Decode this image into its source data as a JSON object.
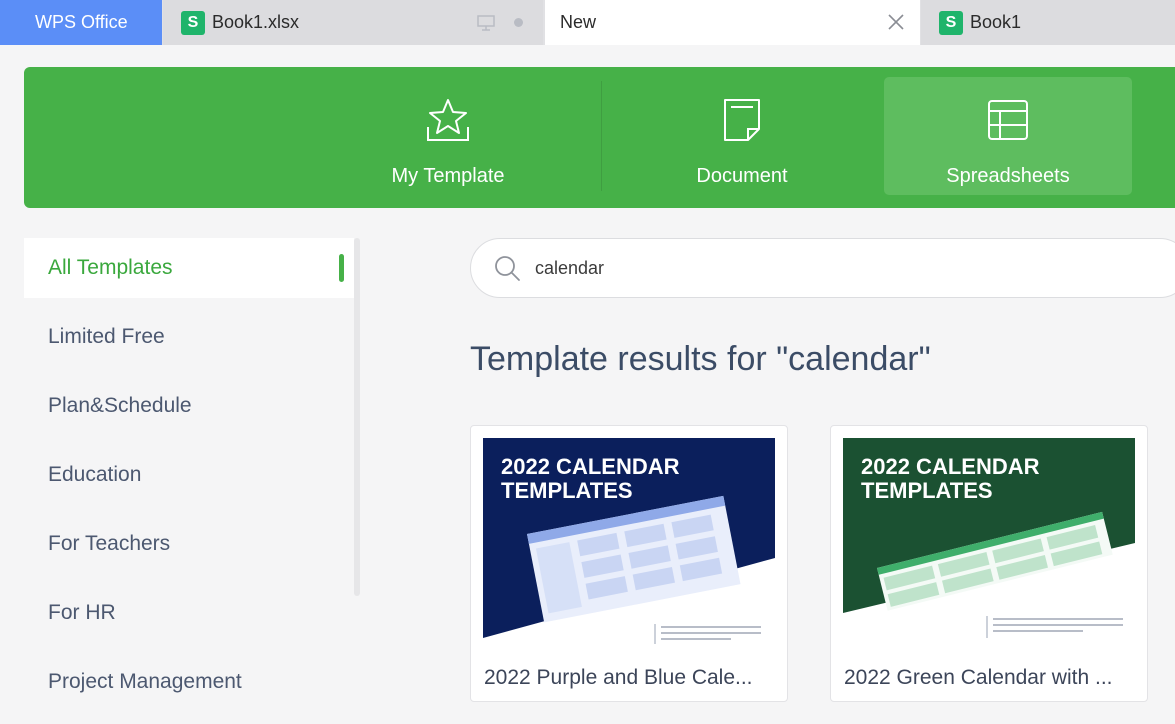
{
  "tabs": {
    "wps": "WPS Office",
    "book1xlsx": "Book1.xlsx",
    "new": "New",
    "book1": "Book1"
  },
  "header": {
    "my_template": "My Template",
    "document": "Document",
    "spreadsheets": "Spreadsheets",
    "active": "Spreadsheets"
  },
  "sidebar": {
    "items": [
      {
        "label": "All Templates",
        "active": true
      },
      {
        "label": "Limited Free"
      },
      {
        "label": "Plan&Schedule"
      },
      {
        "label": "Education"
      },
      {
        "label": "For Teachers"
      },
      {
        "label": "For HR"
      },
      {
        "label": "Project Management"
      }
    ]
  },
  "search": {
    "value": "calendar"
  },
  "results": {
    "title": "Template results for \"calendar\"",
    "cards": [
      {
        "title": "2022 Purple and Blue Cale...",
        "thumb_heading_1": "2022 CALENDAR",
        "thumb_heading_2": "TEMPLATES",
        "bg_color": "#0b1f5c"
      },
      {
        "title": "2022 Green Calendar with ...",
        "thumb_heading_1": "2022 CALENDAR",
        "thumb_heading_2": "TEMPLATES",
        "bg_color": "#1b5132"
      }
    ]
  },
  "colors": {
    "accent_green": "#46b148",
    "wps_blue": "#5b8ef7"
  }
}
